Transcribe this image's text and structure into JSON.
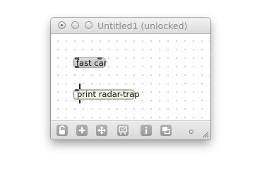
{
  "window": {
    "title": "Untitled1 (unlocked)"
  },
  "patcher": {
    "message_box": {
      "text": "fast car"
    },
    "object_box": {
      "text": "print radar-trap"
    }
  },
  "toolbar": {
    "buttons": [
      {
        "icon": "lock-icon"
      },
      {
        "icon": "plus-icon"
      },
      {
        "icon": "move-arrows-icon"
      },
      {
        "icon": "presentation-easel-icon"
      },
      {
        "icon": "info-icon"
      },
      {
        "icon": "window-copy-icon"
      }
    ]
  },
  "colors": {
    "message_box_bg": "#c8c8c8",
    "object_box_border": "#b7b8a0",
    "toolbar_button": "#a4a4a4"
  }
}
